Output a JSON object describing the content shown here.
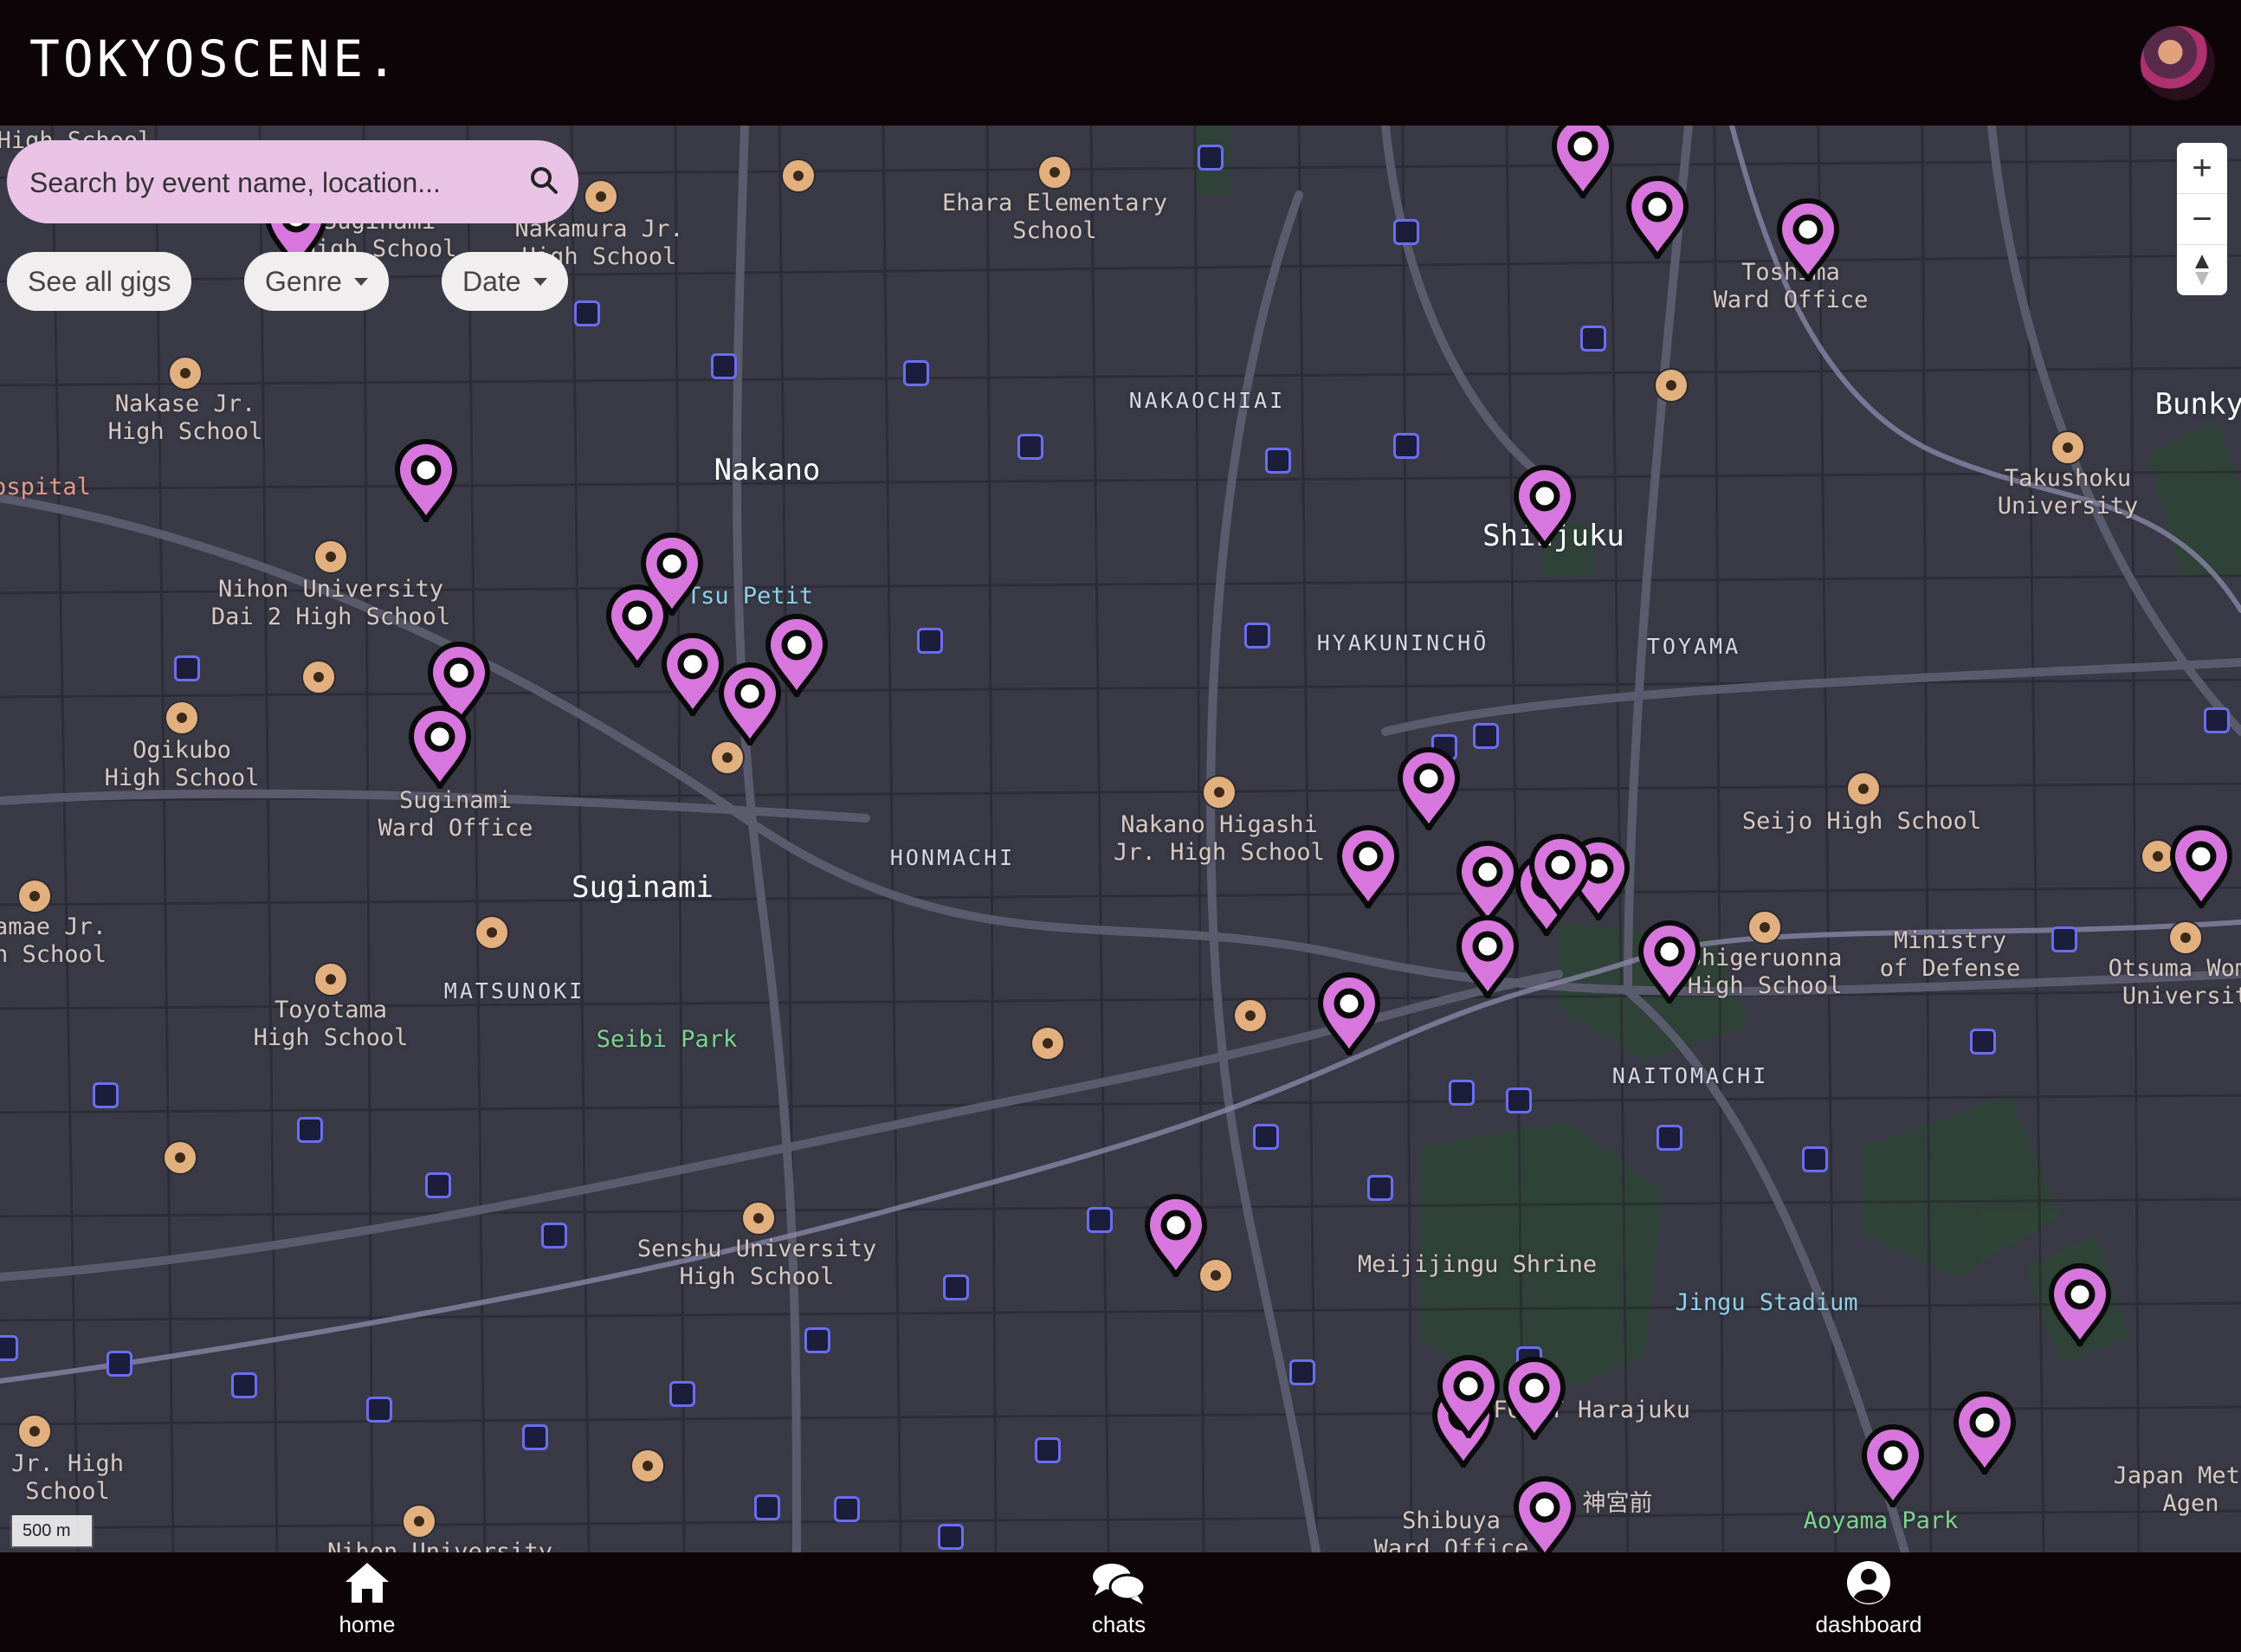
{
  "app": {
    "title": "TOKYOSCENE."
  },
  "search": {
    "placeholder": "Search by event name, location..."
  },
  "filters": {
    "see_all": "See all gigs",
    "genre": "Genre",
    "date": "Date"
  },
  "map_controls": {
    "zoom_in": "+",
    "zoom_out": "−"
  },
  "scale_label": "500 m",
  "accent_color": "#d777dd",
  "map_labels": {
    "nakano": "Nakano",
    "shinjuku": "Shinjuku",
    "suginami": "Suginami",
    "bunkyo": "Bunkyo",
    "nakaochiai": "NAKAOCHIAI",
    "hyakunincho": "HYAKUNINCHŌ",
    "toyama": "TOYAMA",
    "honmachi": "HONMACHI",
    "matsunoki": "MATSUNOKI",
    "naitomachi": "NAITOMACHI",
    "hospital": "ospital",
    "high_school_top": "High School",
    "suginami_school": "Suginami\nHigh School",
    "nakamura": "Nakamura Jr.\nHigh School",
    "ehara": "Ehara Elementary\nSchool",
    "toshima": "Toshima\nWard Office",
    "nakase": "Nakase Jr.\nHigh School",
    "takushoku": "Takushoku\nUniversity",
    "nihon_dai2": "Nihon University\nDai 2 High School",
    "petit": "Tsu Petit",
    "ogikubo": "Ogikubo\nHigh School",
    "suginami_ward": "Suginami\nWard Office",
    "nakano_higashi": "Nakano Higashi\nJr. High School",
    "seijo": "Seijo High School",
    "yamae": "amae Jr.\nh School",
    "toyotama": "Toyotama\nHigh School",
    "seibi": "Seibi Park",
    "shigeruonna": "Shigeruonna\nHigh School",
    "ministry": "Ministry\nof Defense",
    "otsuma": "Otsuma Wome\nUniversit",
    "senshu": "Senshu University\nHigh School",
    "meijijingu": "Meijijingu Shrine",
    "jingu": "Jingu Stadium",
    "jr_high": "Jr. High\nSchool",
    "laforet": "LAFORET Harajuku",
    "jingumae": "神宮前",
    "shibuya": "Shibuya\nWard Office",
    "aoyama": "Aoyama Park",
    "japan_meteo": "Japan Meteo\nAgen",
    "nihon_university": "Nihon University"
  },
  "nav": {
    "home": "home",
    "chats": "chats",
    "dashboard": "dashboard"
  }
}
